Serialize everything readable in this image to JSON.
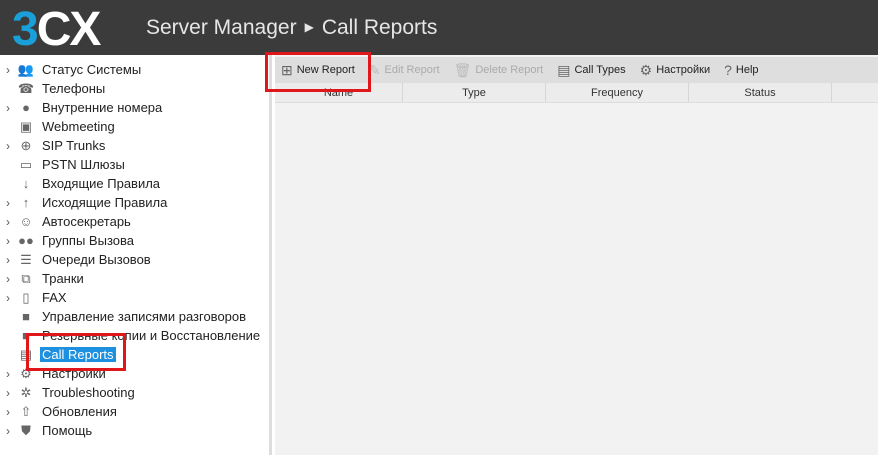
{
  "header": {
    "logo": "3CX",
    "crumb1": "Server Manager",
    "crumb2": "Call Reports"
  },
  "sidebar": {
    "items": [
      {
        "label": "Статус Системы",
        "icon": "system-status-icon",
        "expand": true
      },
      {
        "label": "Телефоны",
        "icon": "phone-icon",
        "expand": false
      },
      {
        "label": "Внутренние номера",
        "icon": "user-icon",
        "expand": true
      },
      {
        "label": "Webmeeting",
        "icon": "webmeeting-icon",
        "expand": false
      },
      {
        "label": "SIP Trunks",
        "icon": "globe-icon",
        "expand": true
      },
      {
        "label": "PSTN Шлюзы",
        "icon": "gateway-icon",
        "expand": false
      },
      {
        "label": "Входящие Правила",
        "icon": "arrow-down-icon",
        "expand": false
      },
      {
        "label": "Исходящие Правила",
        "icon": "arrow-up-icon",
        "expand": true
      },
      {
        "label": "Автосекретарь",
        "icon": "receptionist-icon",
        "expand": true
      },
      {
        "label": "Группы Вызова",
        "icon": "group-icon",
        "expand": true
      },
      {
        "label": "Очереди Вызовов",
        "icon": "queue-icon",
        "expand": true
      },
      {
        "label": "Транки",
        "icon": "trunk-icon",
        "expand": true
      },
      {
        "label": "FAX",
        "icon": "fax-icon",
        "expand": true
      },
      {
        "label": "Управление записями разговоров",
        "icon": "folder-icon",
        "expand": false
      },
      {
        "label": "Резервные копии и Восстановление",
        "icon": "folder-icon",
        "expand": false
      },
      {
        "label": "Call Reports",
        "icon": "report-icon",
        "expand": false,
        "selected": true
      },
      {
        "label": "Настройки",
        "icon": "gear-icon",
        "expand": true
      },
      {
        "label": "Troubleshooting",
        "icon": "bug-icon",
        "expand": true
      },
      {
        "label": "Обновления",
        "icon": "upload-icon",
        "expand": true
      },
      {
        "label": "Помощь",
        "icon": "help-shield-icon",
        "expand": true
      }
    ]
  },
  "toolbar": {
    "buttons": [
      {
        "label": "New Report",
        "icon": "new-report-icon",
        "enabled": true
      },
      {
        "label": "Edit Report",
        "icon": "edit-icon",
        "enabled": false
      },
      {
        "label": "Delete Report",
        "icon": "trash-icon",
        "enabled": false
      },
      {
        "label": "Call Types",
        "icon": "document-icon",
        "enabled": true
      },
      {
        "label": "Настройки",
        "icon": "gears-icon",
        "enabled": true
      },
      {
        "label": "Help",
        "icon": "help-icon",
        "enabled": true
      }
    ]
  },
  "table": {
    "columns": [
      "Name",
      "Type",
      "Frequency",
      "Status"
    ]
  },
  "colors": {
    "header": "#3b3b3b",
    "accent": "#1a9fd9",
    "selection": "#1e90e0",
    "highlight": "#e0161b"
  }
}
